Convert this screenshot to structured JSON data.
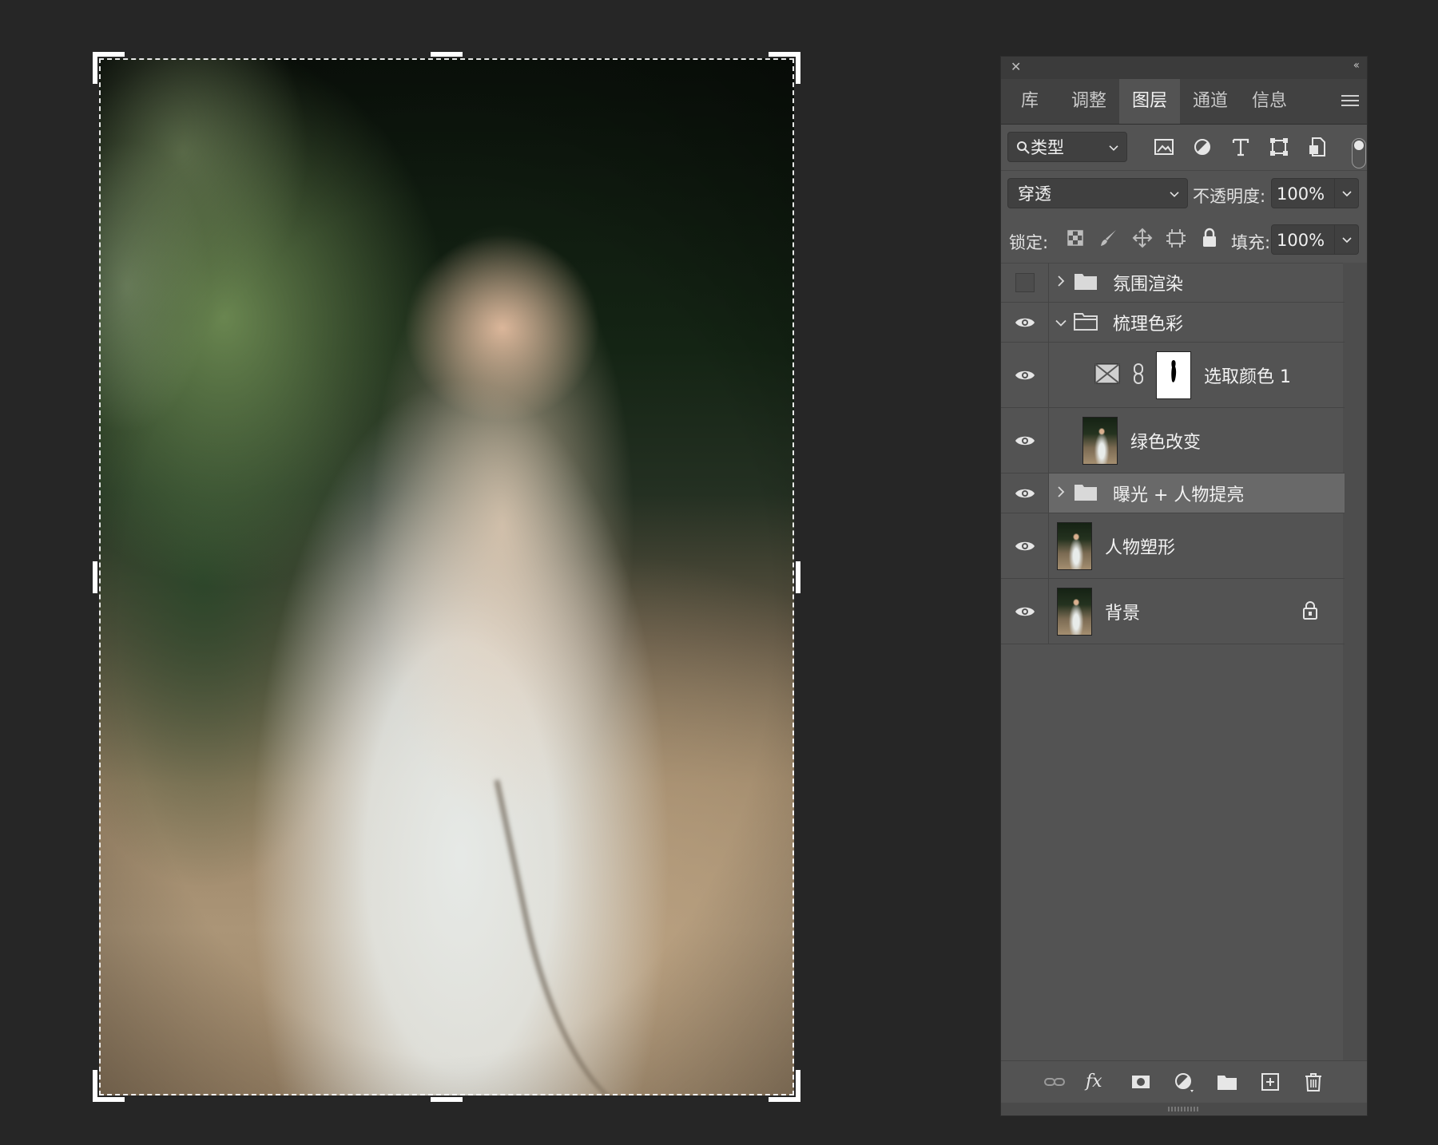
{
  "canvas": {
    "image": "portrait-photo"
  },
  "panel": {
    "tabs": [
      {
        "label": "库"
      },
      {
        "label": "调整"
      },
      {
        "label": "图层"
      },
      {
        "label": "通道"
      },
      {
        "label": "信息"
      }
    ],
    "active_tab": "图层",
    "filter": {
      "value": "类型",
      "icons": [
        "image-icon",
        "adjustment-icon",
        "type-icon",
        "shape-icon",
        "smart-object-icon"
      ]
    },
    "blend_mode": "穿透",
    "opacity_label": "不透明度:",
    "opacity": "100%",
    "lock_label": "锁定:",
    "lock_icons": [
      "lock-transparent-icon",
      "lock-image-icon",
      "lock-position-icon",
      "lock-artboard-icon",
      "lock-all-icon"
    ],
    "fill_label": "填充:",
    "fill": "100%",
    "layers": [
      {
        "name": "氛围渲染",
        "visible": false
      },
      {
        "name": "梳理色彩",
        "visible": true
      },
      {
        "name": "选取颜色 1",
        "visible": true
      },
      {
        "name": "绿色改变",
        "visible": true
      },
      {
        "name": "曝光 + 人物提亮",
        "visible": true,
        "selected": true
      },
      {
        "name": "人物塑形",
        "visible": true
      },
      {
        "name": "背景",
        "visible": true,
        "locked": true
      }
    ],
    "toolbar_icons": [
      "link-layers-icon",
      "fx-icon",
      "add-mask-icon",
      "new-adjustment-icon",
      "new-group-icon",
      "new-layer-icon",
      "delete-icon"
    ],
    "fx_label": "fx"
  }
}
